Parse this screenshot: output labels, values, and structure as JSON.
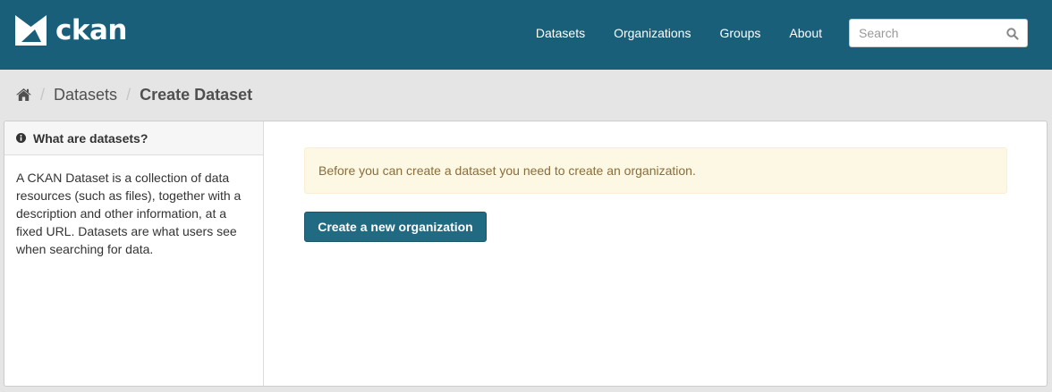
{
  "brand": {
    "name": "ckan",
    "logo_icon": "ckan-envelope-logo-icon"
  },
  "colors": {
    "header_bg": "#1a5f7a",
    "button_bg": "#206b82",
    "alert_bg": "#fcf8e3",
    "alert_text": "#8a6d3b"
  },
  "nav": {
    "items": [
      {
        "label": "Datasets"
      },
      {
        "label": "Organizations"
      },
      {
        "label": "Groups"
      },
      {
        "label": "About"
      }
    ]
  },
  "search": {
    "placeholder": "Search",
    "value": "",
    "icon": "search-icon"
  },
  "breadcrumb": {
    "home_icon": "home-icon",
    "items": [
      {
        "label": "Datasets"
      },
      {
        "label": "Create Dataset"
      }
    ]
  },
  "sidebar": {
    "heading": "What are datasets?",
    "heading_icon": "info-icon",
    "body": "A CKAN Dataset is a collection of data resources (such as files), together with a description and other information, at a fixed URL. Datasets are what users see when searching for data."
  },
  "main": {
    "alert_text": "Before you can create a dataset you need to create an organization.",
    "create_org_button": "Create a new organization"
  }
}
